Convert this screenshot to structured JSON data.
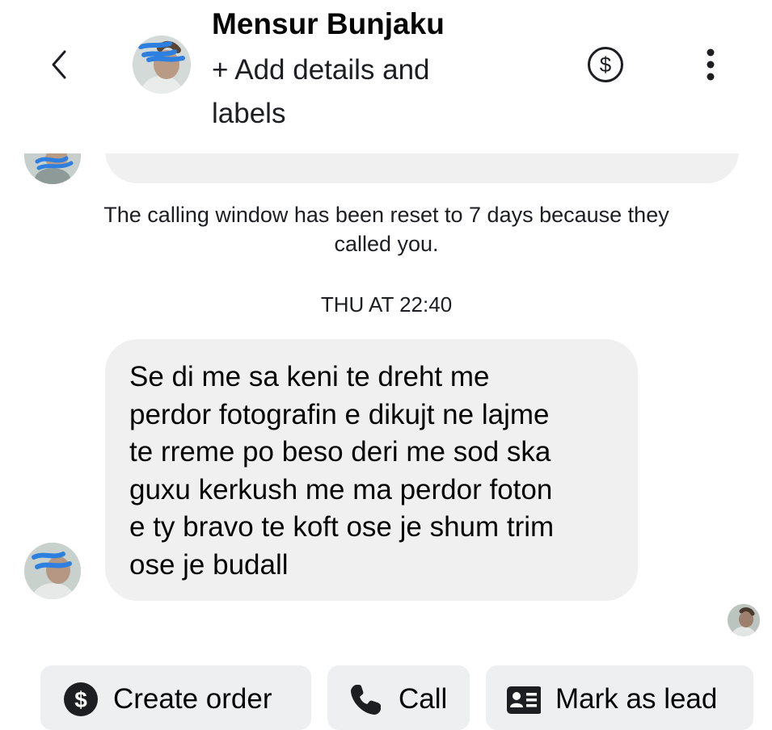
{
  "header": {
    "contact_name": "Mensur Bunjaku",
    "add_details_label": "+ Add details and labels",
    "back_icon": "chevron-left-icon",
    "payment_icon": "dollar-circle-icon",
    "more_icon": "more-vertical-icon"
  },
  "conversation": {
    "system_note": "The calling window has been reset to 7 days because they called you.",
    "timestamp": "THU AT 22:40",
    "message": "Se di me sa keni te dreht me\nperdor fotografin e dikujt ne lajme\nte rreme po beso deri me sod ska\nguxu kerkush me ma perdor foton\ne ty bravo te koft ose je shum trim\nose je budall"
  },
  "actions": {
    "create_order": "Create order",
    "call": "Call",
    "mark_as_lead": "Mark as lead"
  },
  "colors": {
    "bubble": "#f0f0f0",
    "chip": "#eeeff1",
    "text": "#050505",
    "scribble": "#2d7fe0"
  }
}
